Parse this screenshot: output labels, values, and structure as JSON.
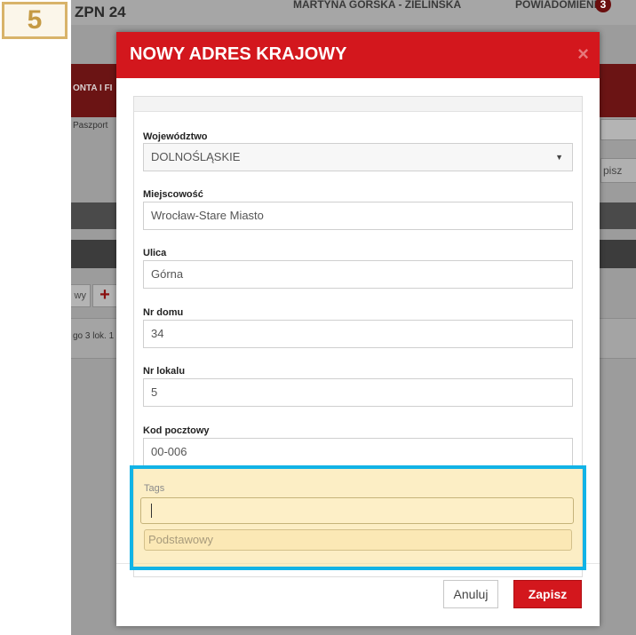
{
  "step_badge": "5",
  "background": {
    "logo_text": "ZPN 24",
    "user_text": "MARTYNA GÓRSKA - ZIELIŃSKA",
    "notifications_label": "POWIADOMIENIA",
    "notifications_count": "3",
    "red_bar_label": "ONTA I FI",
    "paszport_label": "Paszport",
    "right_button_label": "pisz",
    "small_button_label": "wy",
    "add_button_label": "+",
    "list_item_text": "go 3 lok. 1"
  },
  "modal": {
    "title": "NOWY ADRES KRAJOWY",
    "close_glyph": "×",
    "fields": {
      "wojewodztwo": {
        "label": "Województwo",
        "value": "DOLNOŚLĄSKIE"
      },
      "miejscowosc": {
        "label": "Miejscowość",
        "value": "Wrocław-Stare Miasto"
      },
      "ulica": {
        "label": "Ulica",
        "value": "Górna"
      },
      "nr_domu": {
        "label": "Nr domu",
        "value": "34"
      },
      "nr_lokalu": {
        "label": "Nr lokalu",
        "value": "5"
      },
      "kod_pocztowy": {
        "label": "Kod pocztowy",
        "value": "00-006"
      }
    },
    "tags": {
      "label": "Tags",
      "input_value": "",
      "chip": "Podstawowy"
    },
    "buttons": {
      "cancel": "Anuluj",
      "save": "Zapisz"
    }
  },
  "colors": {
    "brand_red": "#d3171d",
    "highlight_border": "#12b3e6",
    "highlight_fill": "#fae096",
    "badge_border": "#d8b36a"
  }
}
